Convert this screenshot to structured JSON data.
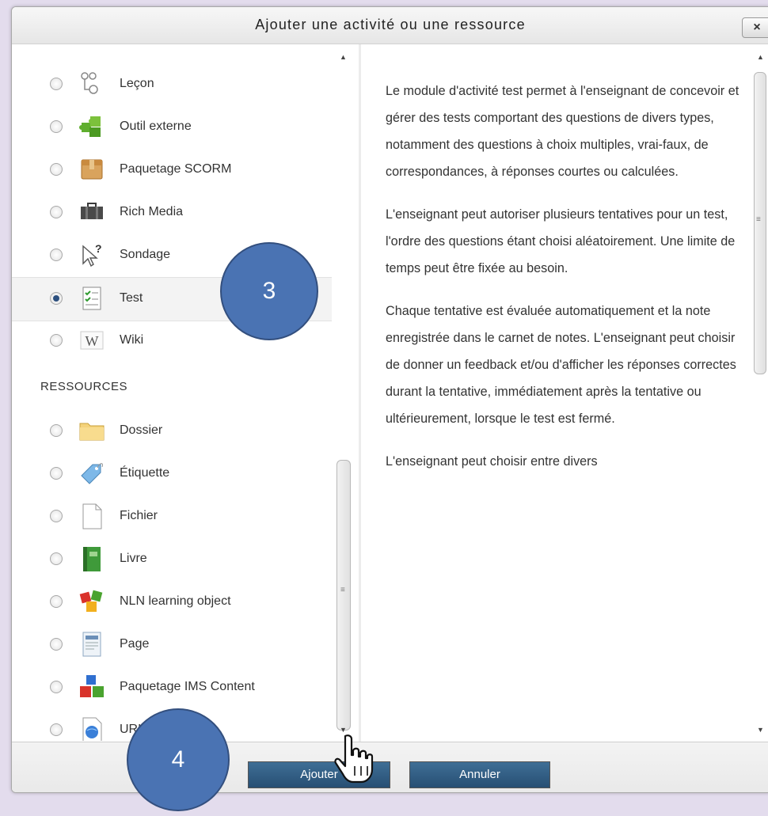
{
  "dialog": {
    "title": "Ajouter une activité ou une ressource",
    "close_label": "×"
  },
  "activities": [
    {
      "label": "Leçon",
      "icon": "lesson-icon",
      "selected": false
    },
    {
      "label": "Outil externe",
      "icon": "puzzle-icon",
      "selected": false
    },
    {
      "label": "Paquetage SCORM",
      "icon": "package-box-icon",
      "selected": false
    },
    {
      "label": "Rich Media",
      "icon": "briefcase-icon",
      "selected": false
    },
    {
      "label": "Sondage",
      "icon": "cursor-question-icon",
      "selected": false
    },
    {
      "label": "Test",
      "icon": "checklist-icon",
      "selected": true
    },
    {
      "label": "Wiki",
      "icon": "wiki-w-icon",
      "selected": false
    }
  ],
  "resources_header": "RESSOURCES",
  "resources": [
    {
      "label": "Dossier",
      "icon": "folder-icon"
    },
    {
      "label": "Étiquette",
      "icon": "tag-icon"
    },
    {
      "label": "Fichier",
      "icon": "file-icon"
    },
    {
      "label": "Livre",
      "icon": "book-icon"
    },
    {
      "label": "NLN learning object",
      "icon": "cubes-icon"
    },
    {
      "label": "Page",
      "icon": "page-icon"
    },
    {
      "label": "Paquetage IMS Content",
      "icon": "ims-blocks-icon"
    },
    {
      "label": "URL",
      "icon": "url-globe-icon"
    }
  ],
  "description": [
    "Le module d'activité test permet à l'enseignant de concevoir et gérer des tests comportant des questions de divers types, notamment des questions à choix multiples, vrai-faux, de correspondances, à réponses courtes ou calculées.",
    "L'enseignant peut autoriser plusieurs tentatives pour un test, l'ordre des questions étant choisi aléatoirement. Une limite de temps peut être fixée au besoin.",
    "Chaque tentative est évaluée automatiquement et la note enregistrée dans le carnet de notes. L'enseignant peut choisir de donner un feedback et/ou d'afficher les réponses correctes durant la tentative, immédiatement après la tentative ou ultérieurement, lorsque le test est fermé.",
    "L'enseignant peut choisir entre divers"
  ],
  "footer": {
    "add_label": "Ajouter",
    "cancel_label": "Annuler"
  },
  "callouts": {
    "step3": "3",
    "step4": "4"
  },
  "colors": {
    "background": "#e3dced",
    "button": "#2f5a80",
    "callout": "#4a73b3",
    "radio_checked": "#2c4f7e"
  }
}
